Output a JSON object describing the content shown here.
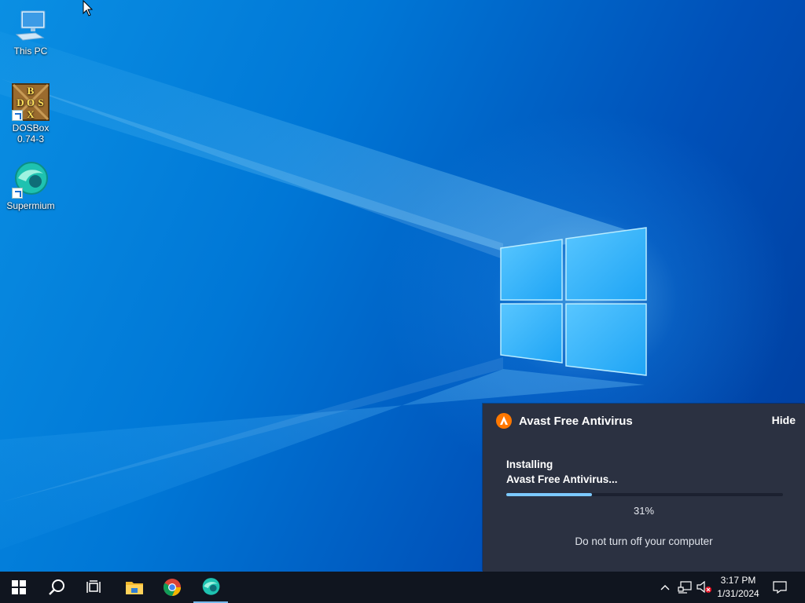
{
  "desktop": {
    "icons": [
      {
        "label": "This PC",
        "icon": "computer-icon"
      },
      {
        "label": "DOSBox\n0.74-3",
        "line1": "DOSBox",
        "line2": "0.74-3",
        "icon": "dosbox-icon"
      },
      {
        "label": "Supermium",
        "icon": "supermium-icon"
      }
    ],
    "dosbox_letters": [
      "B",
      "D",
      "O",
      "S",
      "X"
    ]
  },
  "avast": {
    "title": "Avast Free Antivirus",
    "hide_label": "Hide",
    "status_line1": "Installing",
    "status_line2": "Avast Free Antivirus...",
    "progress_percent": 31,
    "progress_text": "31%",
    "note": "Do not turn off your computer",
    "accent": "#ff7800"
  },
  "taskbar": {
    "buttons": [
      "windows-start-icon",
      "search-icon",
      "task-view-icon",
      "file-explorer-icon",
      "chrome-icon",
      "supermium-icon"
    ],
    "tray_icons": [
      "chevron-up-icon",
      "network-icon",
      "volume-muted-icon",
      "notification-icon"
    ],
    "time": "3:17 PM",
    "date": "1/31/2024"
  },
  "colors": {
    "taskbar": "#10151f",
    "panel": "#2b3141",
    "progress": "#7cc9ff"
  }
}
